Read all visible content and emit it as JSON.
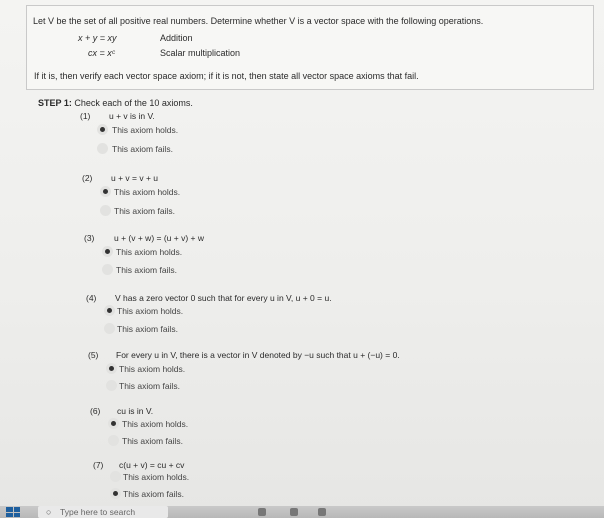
{
  "problem": {
    "intro": "Let V be the set of all positive real numbers. Determine whether V is a vector space with the following operations.",
    "operations": [
      {
        "expr": "x + y = xy",
        "label": "Addition"
      },
      {
        "expr": "cx = xᶜ",
        "label": "Scalar multiplication"
      }
    ],
    "instruction": "If it is, then verify each vector space axiom; if it is not, then state all vector space axioms that fail."
  },
  "step": {
    "title_bold": "STEP 1:",
    "title_rest": " Check each of the 10 axioms."
  },
  "axioms": [
    {
      "num": "(1)",
      "text": "u + v is in V.",
      "holds": "This axiom holds.",
      "fails": "This axiom fails.",
      "selected": "holds"
    },
    {
      "num": "(2)",
      "text": "u + v = v + u",
      "holds": "This axiom holds.",
      "fails": "This axiom fails.",
      "selected": "holds"
    },
    {
      "num": "(3)",
      "text": "u + (v + w) = (u + v) + w",
      "holds": "This axiom holds.",
      "fails": "This axiom fails.",
      "selected": "holds"
    },
    {
      "num": "(4)",
      "text": "V has a zero vector 0 such that for every u in V, u + 0 = u.",
      "holds": "This axiom holds.",
      "fails": "This axiom fails.",
      "selected": "holds"
    },
    {
      "num": "(5)",
      "text": "For every u in V, there is a vector in V denoted by −u such that u + (−u) = 0.",
      "holds": "This axiom holds.",
      "fails": "This axiom fails.",
      "selected": "holds"
    },
    {
      "num": "(6)",
      "text": "cu is in V.",
      "holds": "This axiom holds.",
      "fails": "This axiom fails.",
      "selected": "holds"
    },
    {
      "num": "(7)",
      "text": "c(u + v) = cu + cv",
      "holds": "This axiom holds.",
      "fails": "This axiom fails.",
      "selected": "fails"
    }
  ],
  "taskbar": {
    "search_placeholder": "Type here to search",
    "icons": [
      "windows-start-icon",
      "search-icon"
    ]
  },
  "colors": {
    "radio_bg": "#e2e2e0",
    "radio_dot": "#333333",
    "start_blue": "#1e5f9e"
  }
}
